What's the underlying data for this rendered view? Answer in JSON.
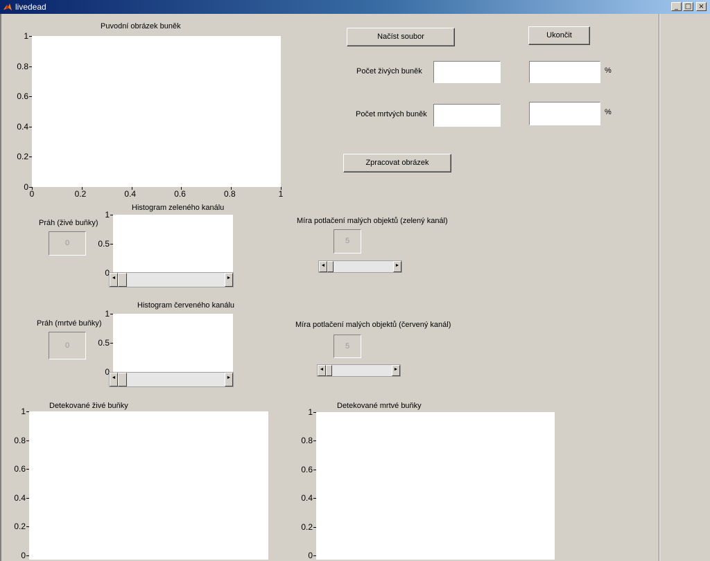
{
  "window": {
    "title": "livedead",
    "icon": "matlab-icon",
    "minimize": "_",
    "maximize": "□",
    "close": "×"
  },
  "buttons": {
    "load": "Načíst soubor",
    "quit": "Ukončit",
    "process": "Zpracovat obrázek"
  },
  "counts": {
    "live_label": "Počet živých buněk",
    "dead_label": "Počet mrtvých buněk",
    "live_value": "",
    "live_percent": "",
    "dead_value": "",
    "dead_percent": "",
    "percent_sign": "%"
  },
  "original": {
    "title": "Puvodní obrázek buněk",
    "yticks": [
      "1",
      "0.8",
      "0.6",
      "0.4",
      "0.2",
      "0"
    ],
    "xticks": [
      "0",
      "0.2",
      "0.4",
      "0.6",
      "0.8",
      "1"
    ]
  },
  "green": {
    "title": "Histogram zeleného kanálu",
    "threshold_label": "Práh (živé buňky)",
    "threshold_value": "0",
    "yticks": [
      "1",
      "0.5",
      "0"
    ],
    "suppression_label": "Míra potlačení malých objektů (zelený kanál)",
    "suppression_value": "5"
  },
  "red": {
    "title": "Histogram červeného kanálu",
    "threshold_label": "Práh (mrtvé buňky)",
    "threshold_value": "0",
    "yticks": [
      "1",
      "0.5",
      "0"
    ],
    "suppression_label": "Míra potlačení malých objektů (červený kanál)",
    "suppression_value": "5"
  },
  "live_detect": {
    "title": "Detekované živé buňky",
    "yticks": [
      "1",
      "0.8",
      "0.6",
      "0.4",
      "0.2",
      "0"
    ]
  },
  "dead_detect": {
    "title": "Detekované mrtvé buňky",
    "yticks": [
      "1",
      "0.8",
      "0.6",
      "0.4",
      "0.2",
      "0"
    ]
  },
  "slider_arrows": {
    "left": "◄",
    "right": "►"
  },
  "colors": {
    "titlebar_start": "#0a246a",
    "titlebar_end": "#a6caf0",
    "panel": "#d4d0c8"
  }
}
